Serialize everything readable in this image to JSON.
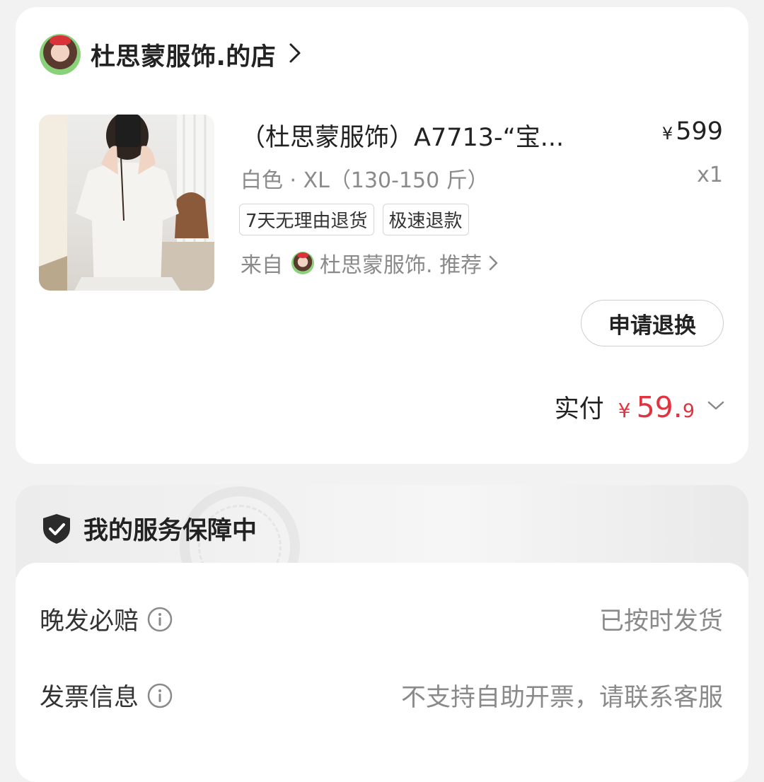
{
  "shop": {
    "name": "杜思蒙服饰.的店"
  },
  "product": {
    "title": "（杜思蒙服饰）A7713-“宝...",
    "price_symbol": "¥",
    "price": "599",
    "spec": "白色 · XL（130-150 斤）",
    "quantity": "x1",
    "tags": [
      "7天无理由退货",
      "极速退款"
    ],
    "source_prefix": "来自",
    "source_name": "杜思蒙服饰. 推荐"
  },
  "actions": {
    "return_label": "申请退换"
  },
  "payment": {
    "label": "实付",
    "symbol": "¥",
    "amount_int": "59.",
    "amount_dec": "9"
  },
  "service": {
    "title": "我的服务保障中",
    "rows": [
      {
        "label": "晚发必赔",
        "value": "已按时发货"
      },
      {
        "label": "发票信息",
        "value": "不支持自助开票，请联系客服"
      }
    ]
  },
  "colors": {
    "accent_red": "#e1333f",
    "secondary_text": "#8a8a8a"
  },
  "icons": [
    "chevron-right-icon",
    "chevron-down-icon",
    "shield-check-icon",
    "info-icon"
  ]
}
